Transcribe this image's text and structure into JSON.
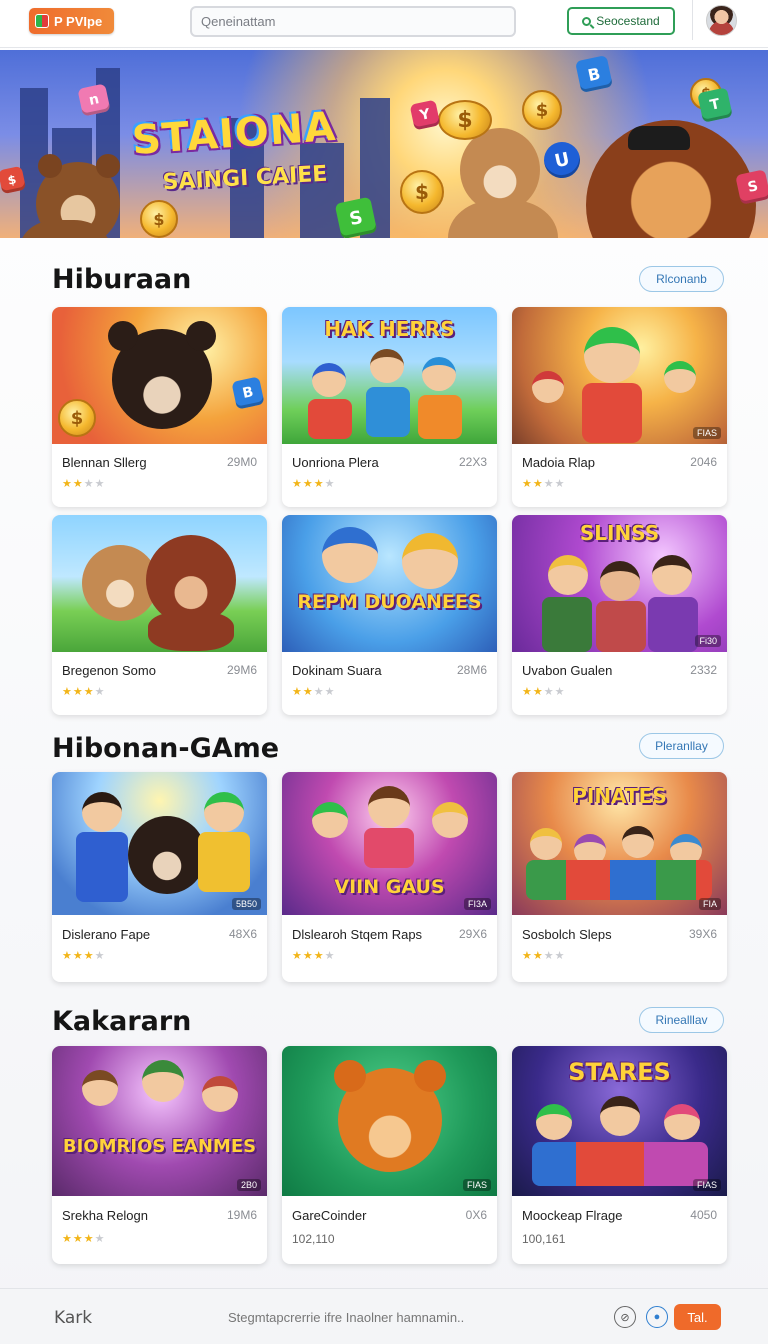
{
  "header": {
    "logo_text": "P PVIpe",
    "search_placeholder": "Qeneinattam",
    "cta_label": "Seocestand"
  },
  "banner": {
    "title": "STAIONA",
    "subtitle": "SAINGI CAIEE"
  },
  "sections": [
    {
      "title": "Hiburaan",
      "pill": "Rlconanb",
      "cards": [
        {
          "name": "Blennan Sllerg",
          "meta": "29M0",
          "stars": 2,
          "tag": ""
        },
        {
          "name": "Uonriona Plera",
          "meta": "22X3",
          "stars": 3,
          "thumb_title": "HAK HERRS",
          "tag": ""
        },
        {
          "name": "Madoia Rlap",
          "meta": "2046",
          "stars": 2,
          "tag": "FIAS"
        },
        {
          "name": "Bregenon Somo",
          "meta": "29M6",
          "stars": 3,
          "tag": ""
        },
        {
          "name": "Dokinam Suara",
          "meta": "28M6",
          "stars": 2,
          "thumb_title": "REPM DUOANEES",
          "tag": ""
        },
        {
          "name": "Uvabon Gualen",
          "meta": "2332",
          "stars": 2,
          "thumb_title": "SLINSS",
          "tag": "Fi30"
        }
      ]
    },
    {
      "title": "Hibonan-GAme",
      "pill": "Pleranllay",
      "cards": [
        {
          "name": "Dislerano Fape",
          "meta": "48X6",
          "stars": 3,
          "tag": "5B50"
        },
        {
          "name": "Dlslearoh Stqem Raps",
          "meta": "29X6",
          "stars": 3,
          "thumb_title": "VIIN GAUS",
          "tag": "FI3A"
        },
        {
          "name": "Sosbolch Sleps",
          "meta": "39X6",
          "stars": 2,
          "thumb_title": "PINATES",
          "tag": "FIA"
        }
      ]
    },
    {
      "title": "Kakararn",
      "pill": "Rinealllav",
      "cards": [
        {
          "name": "Srekha Relogn",
          "meta": "19M6",
          "stars": 3,
          "thumb_title": "BIOMRIOS EANMES",
          "tag": "2B0"
        },
        {
          "name": "GareCoinder",
          "meta": "0X6",
          "sub": "102,110",
          "tag": "FIAS"
        },
        {
          "name": "Moockeap Flrage",
          "meta": "4050",
          "sub": "100,161",
          "thumb_title": "STARES",
          "tag": "FIAS"
        }
      ]
    }
  ],
  "footer": {
    "brand": "Kark",
    "text": "Stegmtapcrerrie ifre Inaolner hamnamin..",
    "button": "Tal."
  },
  "colors": {
    "accent_orange": "#ef6a2a",
    "accent_green": "#2f9e57",
    "pill_blue": "#3477b5",
    "star": "#f2b519"
  }
}
